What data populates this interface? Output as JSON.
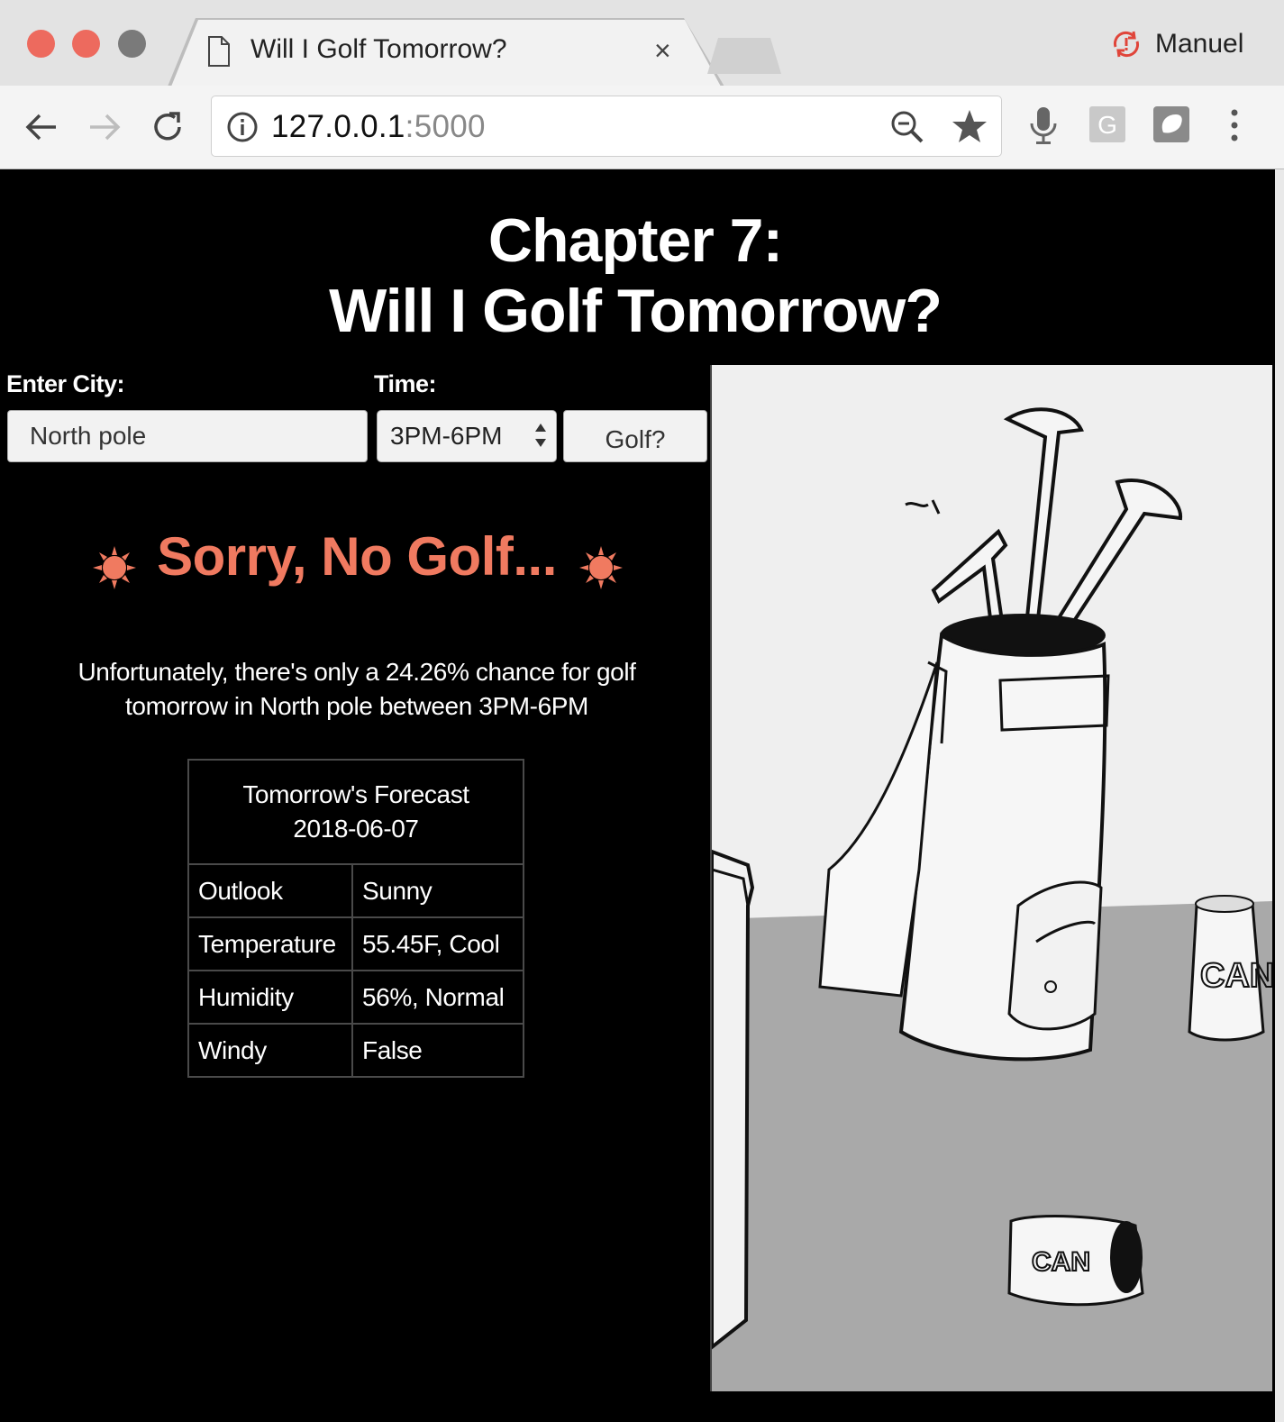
{
  "browser": {
    "tab_title": "Will I Golf Tomorrow?",
    "tab_close": "×",
    "profile_name": "Manuel",
    "url_host": "127.0.0.1",
    "url_port": ":5000",
    "traffic_light_colors": [
      "#ed6a5e",
      "#ed6a5e",
      "#7a7a7a"
    ]
  },
  "page": {
    "title_line1": "Chapter 7:",
    "title_line2": "Will I Golf Tomorrow?",
    "form": {
      "city_label": "Enter City:",
      "city_value": "North pole",
      "time_label": "Time:",
      "time_value": "3PM-6PM",
      "golf_button": "Golf?"
    },
    "verdict": "Sorry, No Golf...",
    "verdict_color": "#f07a60",
    "message_line1": "Unfortunately, there's only a 24.26% chance for golf",
    "message_line2": "tomorrow in North pole between 3PM-6PM",
    "forecast": {
      "title": "Tomorrow's Forecast",
      "date": "2018-06-07",
      "rows": [
        {
          "label": "Outlook",
          "value": "Sunny"
        },
        {
          "label": "Temperature",
          "value": "55.45F, Cool"
        },
        {
          "label": "Humidity",
          "value": "56%, Normal"
        },
        {
          "label": "Windy",
          "value": "False"
        }
      ]
    },
    "illustration": {
      "can_label_1": "CAN",
      "can_label_2": "CAN"
    }
  }
}
